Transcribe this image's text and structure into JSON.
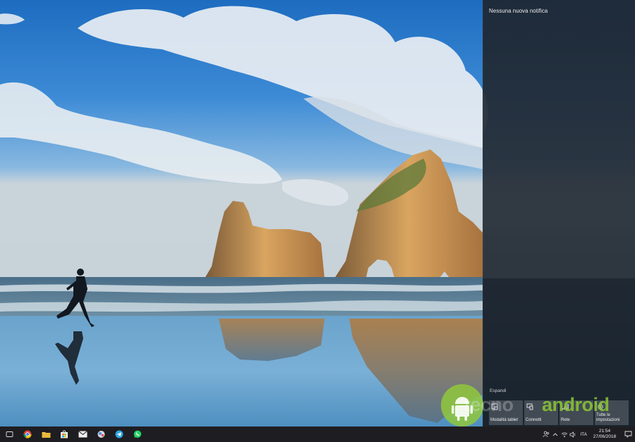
{
  "action_center": {
    "header": "Nessuna nuova notifica",
    "expand_label": "Espandi",
    "quick_actions": [
      {
        "label": "Modalità tablet",
        "icon": "tablet-mode-icon"
      },
      {
        "label": "Connetti",
        "icon": "connect-icon"
      },
      {
        "label": "Rete",
        "icon": "network-icon"
      },
      {
        "label": "Tutte le impostazioni",
        "icon": "settings-icon"
      }
    ]
  },
  "taskbar": {
    "apps": [
      {
        "name": "task-view-icon"
      },
      {
        "name": "chrome-icon"
      },
      {
        "name": "file-explorer-icon"
      },
      {
        "name": "store-icon"
      },
      {
        "name": "mail-icon"
      },
      {
        "name": "app-icon"
      },
      {
        "name": "telegram-icon"
      },
      {
        "name": "whatsapp-icon"
      }
    ],
    "tray": {
      "language": "ITA",
      "time": "21:54",
      "date": "27/06/2018"
    }
  },
  "watermark": {
    "word_left": "tecno",
    "word_right": "android"
  },
  "colors": {
    "taskbar_bg": "#1e1e22",
    "tile_bg": "#50586a",
    "watermark_green": "#8cc832"
  }
}
